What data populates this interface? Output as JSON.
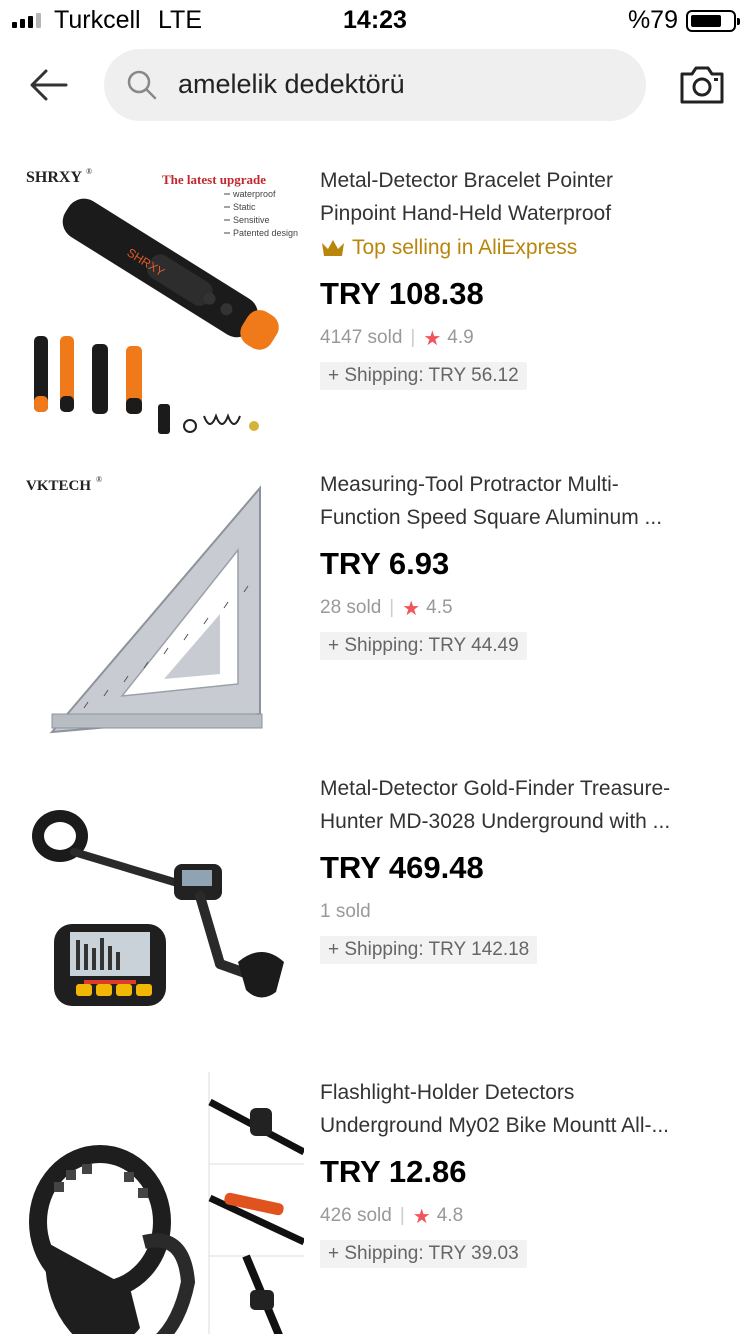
{
  "status_bar": {
    "carrier": "Turkcell",
    "network": "LTE",
    "time": "14:23",
    "battery": "%79"
  },
  "search": {
    "query": "amelelik dedektörü"
  },
  "products": [
    {
      "title_line1": "Metal-Detector Bracelet Pointer",
      "title_line2": "Pinpoint Hand-Held Waterproof",
      "badge": "Top selling in AliExpress",
      "price": "TRY 108.38",
      "sold": "4147 sold",
      "rating": "4.9",
      "shipping": "+ Shipping: TRY 56.12",
      "image": {
        "brand": "SHRXY",
        "headline": "The latest upgrade",
        "features": [
          "waterproof",
          "Static",
          "Sensitive",
          "Patented design"
        ]
      }
    },
    {
      "title_line1": "Measuring-Tool Protractor Multi-",
      "title_line2": "Function Speed Square Aluminum ...",
      "price": "TRY 6.93",
      "sold": "28 sold",
      "rating": "4.5",
      "shipping": "+ Shipping: TRY 44.49",
      "image": {
        "brand": "VKTECH"
      }
    },
    {
      "title_line1": "Metal-Detector Gold-Finder Treasure-",
      "title_line2": "Hunter MD-3028 Underground with ...",
      "price": "TRY 469.48",
      "sold": "1 sold",
      "shipping": "+ Shipping: TRY 142.18"
    },
    {
      "title_line1": "Flashlight-Holder Detectors",
      "title_line2": "Underground My02 Bike Mountt All-...",
      "price": "TRY 12.86",
      "sold": "426 sold",
      "rating": "4.8",
      "shipping": "+ Shipping: TRY 39.03"
    }
  ],
  "colors": {
    "badge": "#b8860b",
    "star": "#f2545b",
    "search_bg": "#efefef"
  }
}
